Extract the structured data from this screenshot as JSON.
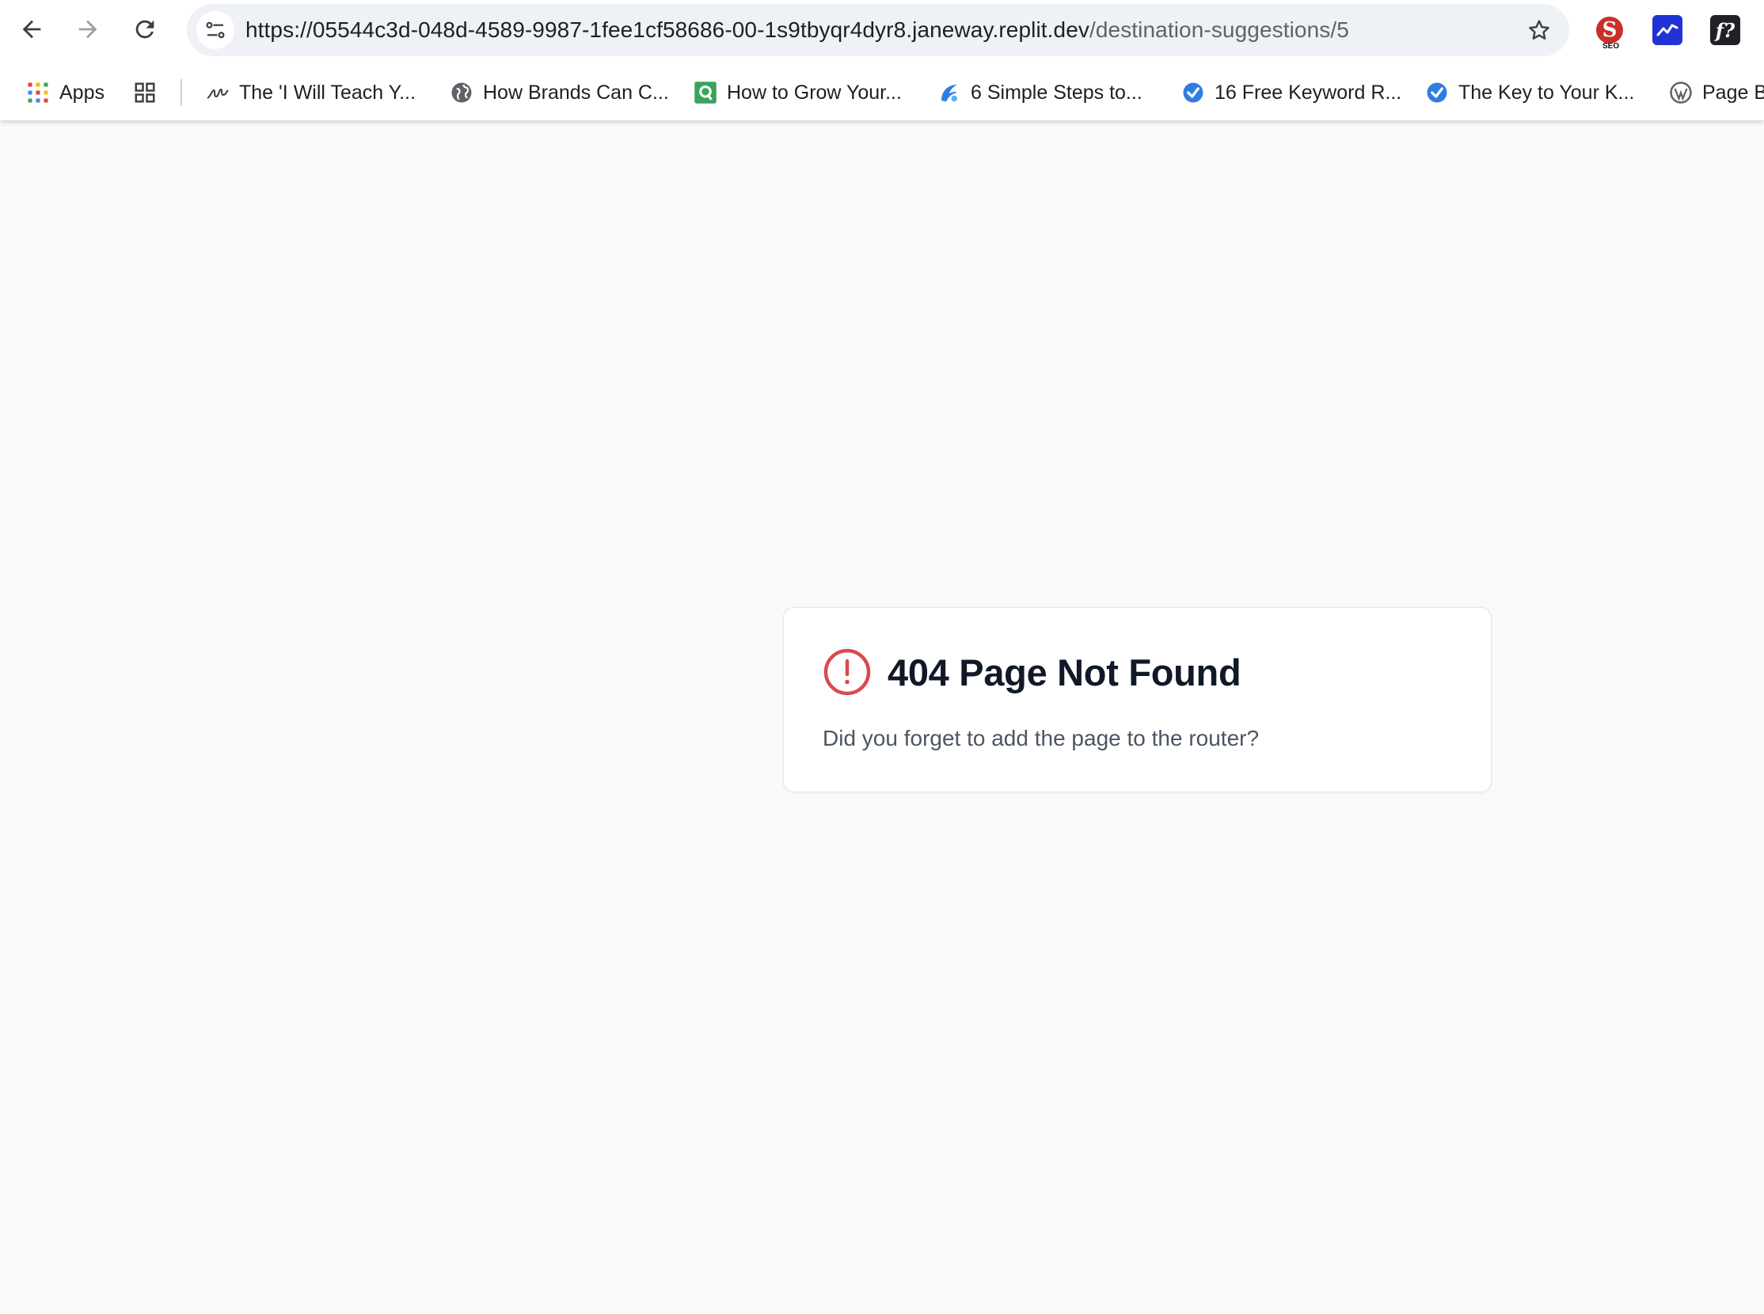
{
  "browser": {
    "url_base": "https://05544c3d-048d-4589-9987-1fee1cf58686-00-1s9tbyqr4dyr8.janeway.replit.dev",
    "url_path": "/destination-suggestions/5",
    "nav_icons": [
      "back-arrow-icon",
      "forward-arrow-icon",
      "reload-icon"
    ],
    "extensions": [
      "seo-extension-icon",
      "trend-extension-icon",
      "fx-extension-icon"
    ],
    "extension_text": {
      "seo_letter": "S",
      "seo_tag": "SEO",
      "fx": "f?"
    }
  },
  "bookmarks": {
    "apps_label": "Apps",
    "items": [
      {
        "label": "The 'I Will Teach Y...",
        "icon": "signature-icon"
      },
      {
        "label": "How Brands Can C...",
        "icon": "globe-icon"
      },
      {
        "label": "How to Grow Your...",
        "icon": "q-green-icon"
      },
      {
        "label": "6 Simple Steps to...",
        "icon": "swirl-blue-icon"
      },
      {
        "label": "16 Free Keyword R...",
        "icon": "verified-check-icon"
      },
      {
        "label": "The Key to Your K...",
        "icon": "verified-check-icon"
      },
      {
        "label": "Page B",
        "icon": "wordpress-icon"
      }
    ]
  },
  "error_card": {
    "title": "404 Page Not Found",
    "message": "Did you forget to add the page to the router?",
    "icon": "alert-circle-icon",
    "icon_color": "#dc4a4a"
  },
  "colors": {
    "page_background": "#f8f9fb",
    "omnibox": "#eef1f6",
    "title_text": "#111827",
    "message_text": "#4b5563"
  }
}
